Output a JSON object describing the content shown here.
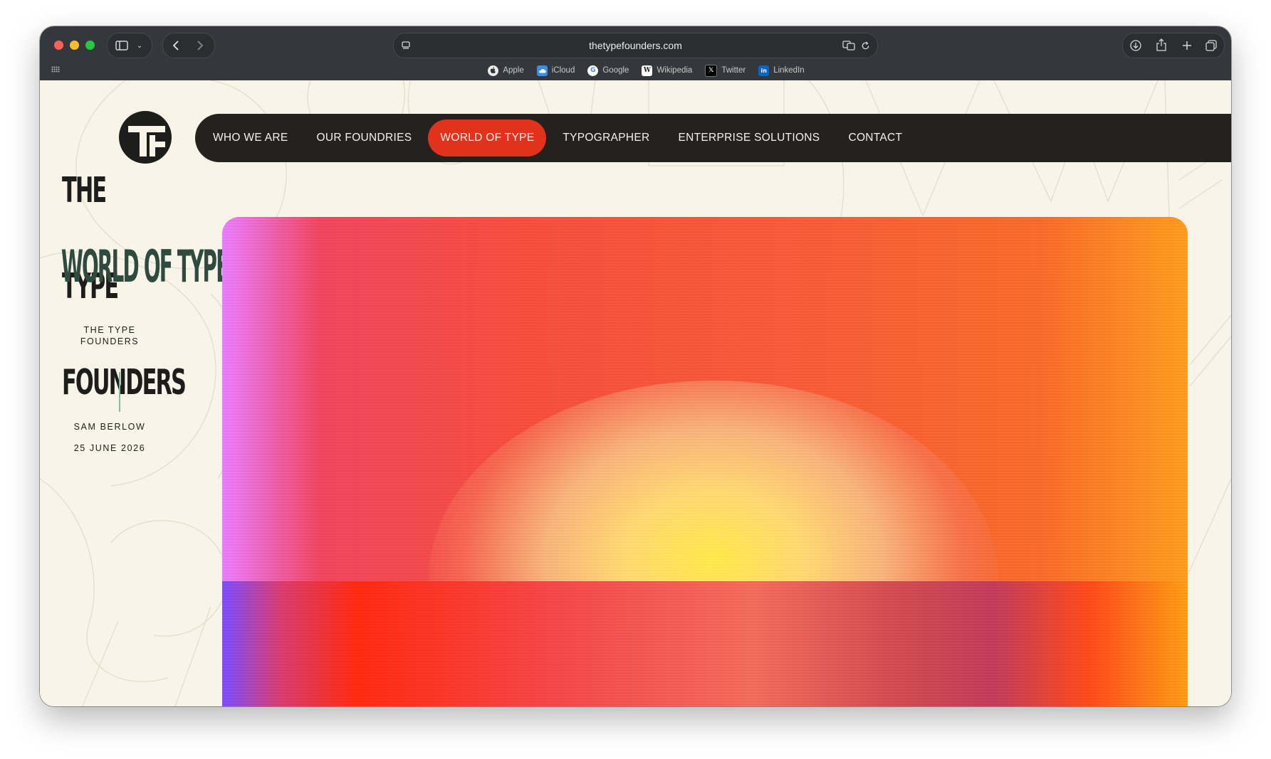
{
  "browser": {
    "url": "thetypefounders.com",
    "favorites": [
      {
        "label": "Apple",
        "icon": "apple-icon",
        "color": "#ffffff"
      },
      {
        "label": "iCloud",
        "icon": "icloud-icon",
        "color": "#5ab0ff"
      },
      {
        "label": "Google",
        "icon": "google-icon",
        "color": "#ffffff"
      },
      {
        "label": "Wikipedia",
        "icon": "wikipedia-icon",
        "color": "#ffffff"
      },
      {
        "label": "Twitter",
        "icon": "x-icon",
        "color": "#000000"
      },
      {
        "label": "LinkedIn",
        "icon": "linkedin-icon",
        "color": "#0a66c2"
      }
    ]
  },
  "site": {
    "logo_lines": [
      "THE",
      "TYPE",
      "FOUNDERS"
    ],
    "section_title": "WORLD OF TYPE",
    "brand_name": "THE TYPE FOUNDERS",
    "author": "SAM BERLOW",
    "date": "25 JUNE 2026"
  },
  "nav": {
    "items": [
      "WHO WE ARE",
      "OUR FOUNDRIES",
      "WORLD OF TYPE",
      "TYPOGRAPHER",
      "ENTERPRISE SOLUTIONS",
      "CONTACT"
    ],
    "active": "WORLD OF TYPE"
  },
  "colors": {
    "background": "#f8f4e8",
    "nav_bg": "#23221f",
    "accent": "#e2321b",
    "title_green": "#2f4a3e",
    "rule_green": "#8db89e"
  }
}
